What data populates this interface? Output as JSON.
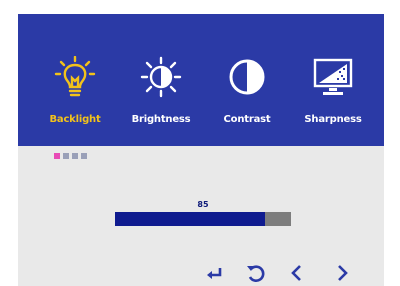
{
  "menu": {
    "tabs": [
      {
        "label": "Backlight",
        "icon": "lightbulb-icon",
        "active": true
      },
      {
        "label": "Brightness",
        "icon": "sun-icon",
        "active": false
      },
      {
        "label": "Contrast",
        "icon": "contrast-icon",
        "active": false
      },
      {
        "label": "Sharpness",
        "icon": "monitor-sharpness-icon",
        "active": false
      }
    ],
    "page_indicator": {
      "count": 4,
      "active_index": 0
    }
  },
  "setting": {
    "value": "85",
    "level": 0.85
  },
  "nav": [
    {
      "icon": "enter-icon"
    },
    {
      "icon": "reset-icon"
    },
    {
      "icon": "left-arrow-icon"
    },
    {
      "icon": "right-arrow-icon"
    }
  ],
  "colors": {
    "menu_bg": "#2b3aa6",
    "panel_bg": "#e9e9e9",
    "active": "#f2c21b",
    "inactive": "#ffffff",
    "bar_fill": "#0f1b8f",
    "bar_track": "#7d7d7d",
    "indicator_active": "#e84bb6",
    "indicator_inactive": "#9aa0b8"
  }
}
